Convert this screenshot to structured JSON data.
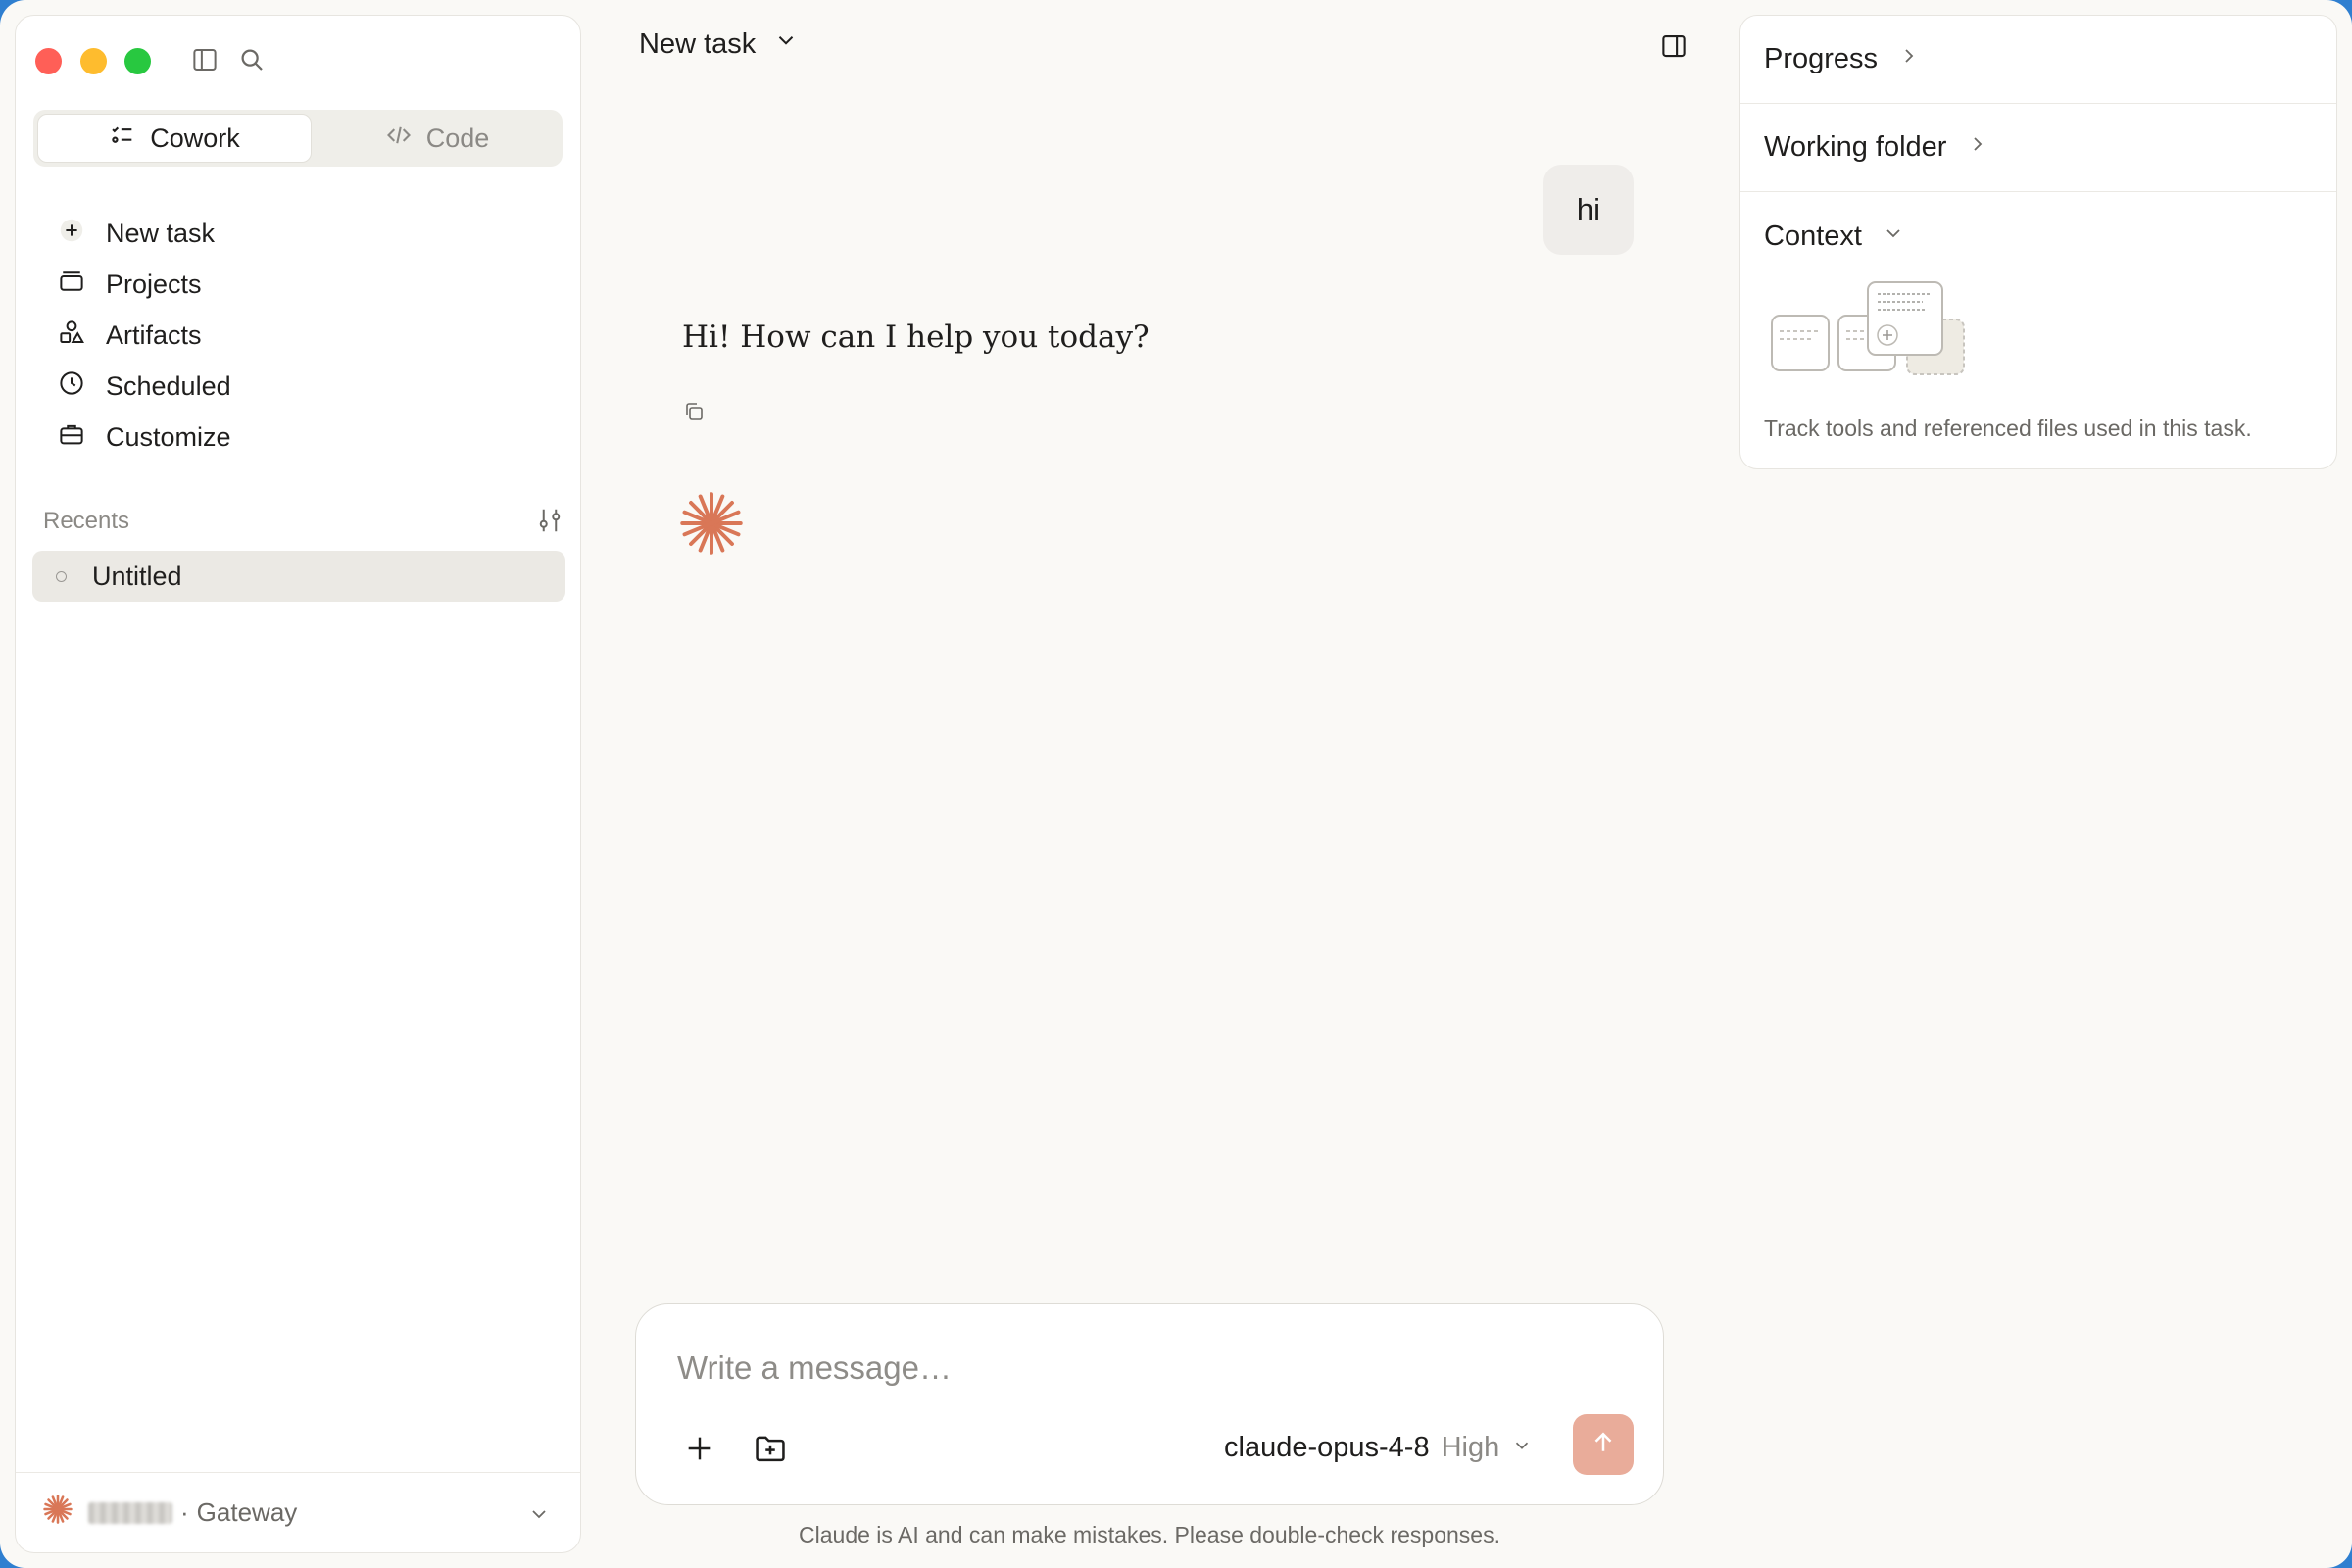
{
  "sidebar": {
    "mode_tabs": [
      {
        "label": "Cowork",
        "active": true,
        "icon": "checklist-icon"
      },
      {
        "label": "Code",
        "active": false,
        "icon": "code-icon"
      }
    ],
    "nav_items": [
      {
        "label": "New task",
        "icon": "plus-circle-icon"
      },
      {
        "label": "Projects",
        "icon": "folder-stack-icon"
      },
      {
        "label": "Artifacts",
        "icon": "shapes-icon"
      },
      {
        "label": "Scheduled",
        "icon": "clock-icon"
      },
      {
        "label": "Customize",
        "icon": "briefcase-icon"
      }
    ],
    "recents_label": "Recents",
    "recents": [
      {
        "label": "Untitled",
        "selected": true
      }
    ],
    "footer": {
      "separator": "·",
      "org_label": "Gateway"
    }
  },
  "header": {
    "title": "New task"
  },
  "conversation": {
    "user_message": "hi",
    "assistant_message": "Hi! How can I help you today?"
  },
  "composer": {
    "placeholder": "Write a message…",
    "model": "claude-opus-4-8",
    "effort": "High"
  },
  "disclaimer": "Claude is AI and can make mistakes. Please double-check responses.",
  "right_panel": {
    "sections": [
      {
        "label": "Progress",
        "state": "collapsed"
      },
      {
        "label": "Working folder",
        "state": "collapsed"
      },
      {
        "label": "Context",
        "state": "expanded"
      }
    ],
    "context_description": "Track tools and referenced files used in this task."
  },
  "colors": {
    "accent": "#d97757",
    "send_button": "#e9ac9a",
    "background": "#faf9f6"
  }
}
